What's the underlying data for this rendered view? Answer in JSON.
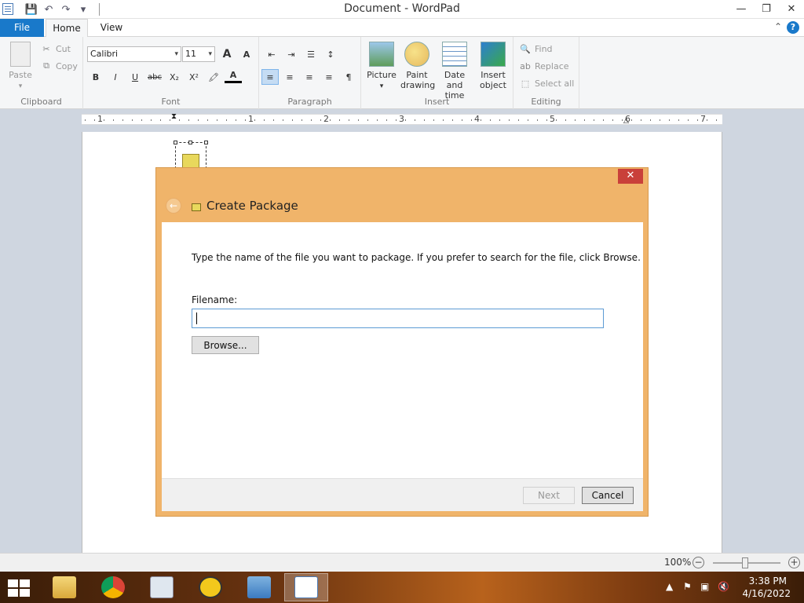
{
  "window": {
    "title": "Document - WordPad",
    "minimize": "—",
    "restore": "❐",
    "close": "✕"
  },
  "quick_access": {
    "save_icon": "save-icon",
    "undo_icon": "undo-icon",
    "redo_icon": "redo-icon",
    "customize_icon": "chevron-down-icon"
  },
  "tabs": {
    "file": "File",
    "home": "Home",
    "view": "View",
    "help": "?"
  },
  "ribbon": {
    "clipboard": {
      "label": "Clipboard",
      "paste": "Paste",
      "cut": "Cut",
      "copy": "Copy"
    },
    "font": {
      "label": "Font",
      "family": "Calibri",
      "size": "11",
      "grow": "A",
      "shrink": "A",
      "bold": "B",
      "italic": "I",
      "underline": "U",
      "strikethrough": "abc",
      "subscript": "X₂",
      "superscript": "X²",
      "color": "A"
    },
    "paragraph": {
      "label": "Paragraph"
    },
    "insert": {
      "label": "Insert",
      "picture": "Picture",
      "paint_drawing_1": "Paint",
      "paint_drawing_2": "drawing",
      "datetime_1": "Date and",
      "datetime_2": "time",
      "insert_object_1": "Insert",
      "insert_object_2": "object"
    },
    "editing": {
      "label": "Editing",
      "find": "Find",
      "replace": "Replace",
      "select_all": "Select all"
    }
  },
  "ruler": {
    "marks": [
      "1",
      "1",
      "2",
      "3",
      "4",
      "5",
      "6",
      "7"
    ]
  },
  "dialog": {
    "title": "Create Package",
    "close": "✕",
    "back": "←",
    "instruction": "Type the name of the file you want to package. If you prefer to search for the file, click Browse.",
    "filename_label": "Filename:",
    "filename_value": "",
    "browse": "Browse...",
    "next": "Next",
    "cancel": "Cancel"
  },
  "statusbar": {
    "zoom": "100%",
    "zoom_out": "−",
    "zoom_in": "+"
  },
  "taskbar": {
    "time": "3:38 PM",
    "date": "4/16/2022"
  },
  "colors": {
    "accent": "#1979ca",
    "dialog_frame": "#f0b46a",
    "close_red": "#c9403a"
  }
}
